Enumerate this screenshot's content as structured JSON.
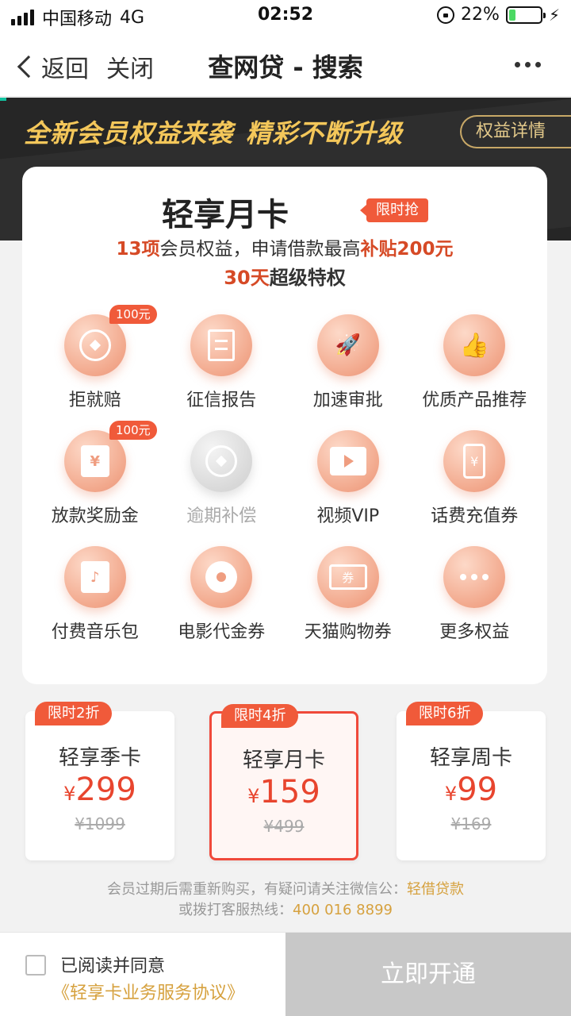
{
  "status_bar": {
    "carrier": "中国移动",
    "network": "4G",
    "time": "02:52",
    "battery": "22%",
    "battery_level": 0.22
  },
  "nav": {
    "back": "返回",
    "close": "关闭",
    "title": "查网贷 - 搜索"
  },
  "banner": {
    "slogan_a": "全新会员权益来袭",
    "slogan_b": "精彩不断升级",
    "details_button": "权益详情"
  },
  "card": {
    "title": "轻享月卡",
    "tag": "限时抢",
    "sub1_a": "13项",
    "sub1_b": "会员权益，申请借款最高",
    "sub1_c": "补贴200元",
    "sub2_a": "30天",
    "sub2_b": "超级特权",
    "benefits": [
      {
        "label": "拒就赔",
        "badge": "100元",
        "icon": "coin-icon"
      },
      {
        "label": "征信报告",
        "icon": "report-icon"
      },
      {
        "label": "加速审批",
        "icon": "rocket-icon"
      },
      {
        "label": "优质产品推荐",
        "icon": "thumbs-up-icon"
      },
      {
        "label": "放款奖励金",
        "badge": "100元",
        "icon": "cash-reward-icon"
      },
      {
        "label": "逾期补偿",
        "icon": "coin-hand-icon",
        "disabled": true
      },
      {
        "label": "视频VIP",
        "icon": "video-icon"
      },
      {
        "label": "话费充值券",
        "icon": "phone-recharge-icon"
      },
      {
        "label": "付费音乐包",
        "icon": "music-icon"
      },
      {
        "label": "电影代金券",
        "icon": "film-icon"
      },
      {
        "label": "天猫购物券",
        "icon": "ticket-icon"
      },
      {
        "label": "更多权益",
        "icon": "more-icon"
      }
    ],
    "glyphs": {
      "yen": "¥",
      "ticket": "券",
      "play": "▶",
      "note": "♪",
      "rocket": "🚀",
      "thumb": "👍"
    }
  },
  "prices": [
    {
      "ribbon": "限时2折",
      "name": "轻享季卡",
      "currency": "¥",
      "price": "299",
      "original": "¥1099"
    },
    {
      "ribbon": "限时4折",
      "name": "轻享月卡",
      "currency": "¥",
      "price": "159",
      "original": "¥499",
      "selected": true
    },
    {
      "ribbon": "限时6折",
      "name": "轻享周卡",
      "currency": "¥",
      "price": "99",
      "original": "¥169"
    }
  ],
  "notes": {
    "line1": "会员过期后需重新购买，有疑问请关注微信公：",
    "wechat": "轻借贷款",
    "line2": "或拨打客服热线：",
    "hotline": "400 016 8899"
  },
  "bottom": {
    "agree": "已阅读并同意",
    "agreement": "《轻享卡业务服务协议》",
    "open_button": "立即开通"
  },
  "colors": {
    "accent_red": "#f05a3a",
    "gold": "#d6a13e",
    "banner_bg": "#262626",
    "open_button_bg": "#c8c8c8"
  }
}
